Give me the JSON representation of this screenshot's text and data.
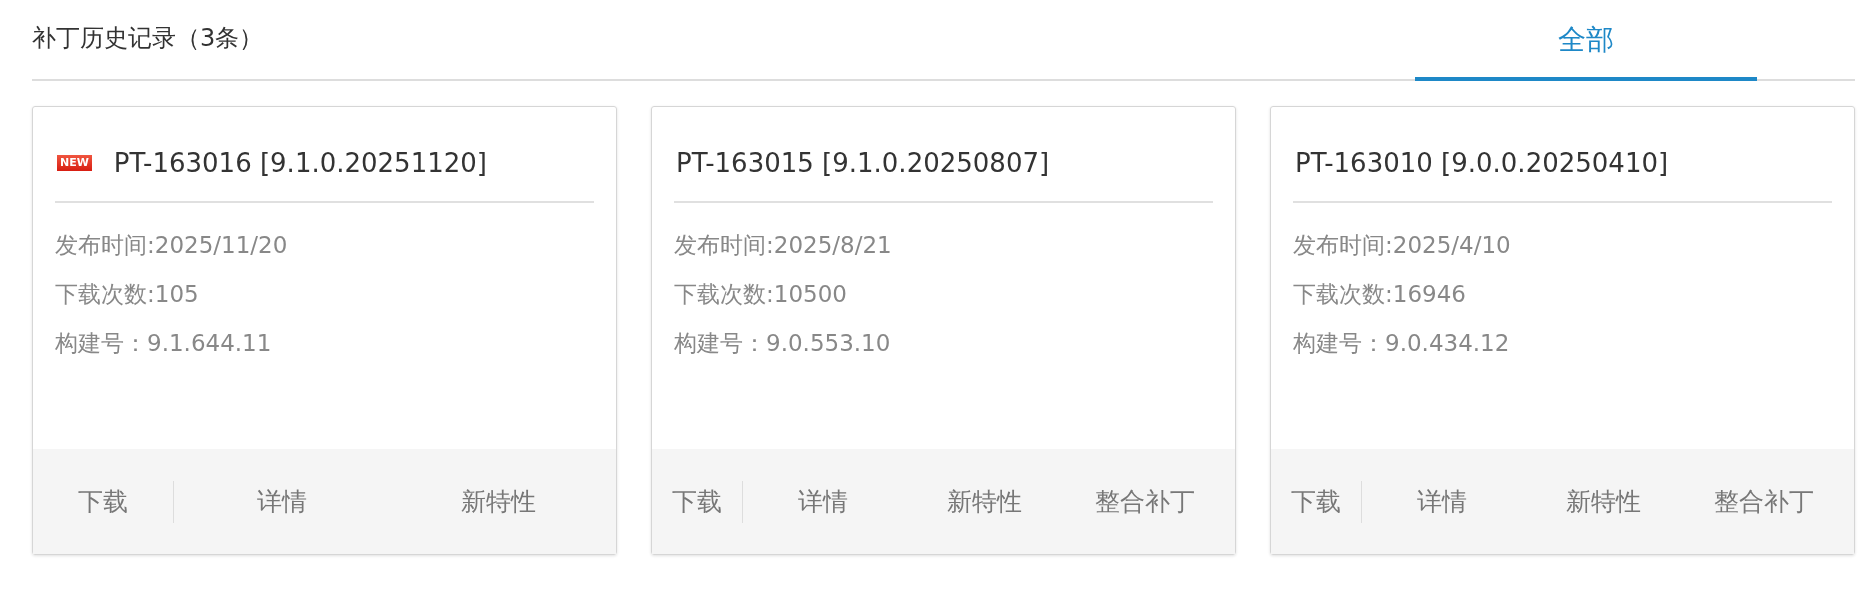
{
  "header": {
    "title": "补丁历史记录（3条）"
  },
  "tabs": [
    {
      "label": "全部",
      "selected": true
    }
  ],
  "cards": [
    {
      "badge": "NEW",
      "title": "PT-163016 [9.1.0.20251120]",
      "fields": [
        "发布时间:2025/11/20",
        "下载次数:105",
        "构建号：9.1.644.11"
      ],
      "actions": [
        "下载",
        "详情",
        "新特性"
      ]
    },
    {
      "title": "PT-163015 [9.1.0.20250807]",
      "fields": [
        "发布时间:2025/8/21",
        "下载次数:10500",
        "构建号：9.0.553.10"
      ],
      "actions": [
        "下载",
        "详情",
        "新特性",
        "整合补丁"
      ]
    },
    {
      "title": "PT-163010 [9.0.0.20250410]",
      "fields": [
        "发布时间:2025/4/10",
        "下载次数:16946",
        "构建号：9.0.434.12"
      ],
      "actions": [
        "下载",
        "详情",
        "新特性",
        "整合补丁"
      ]
    }
  ]
}
